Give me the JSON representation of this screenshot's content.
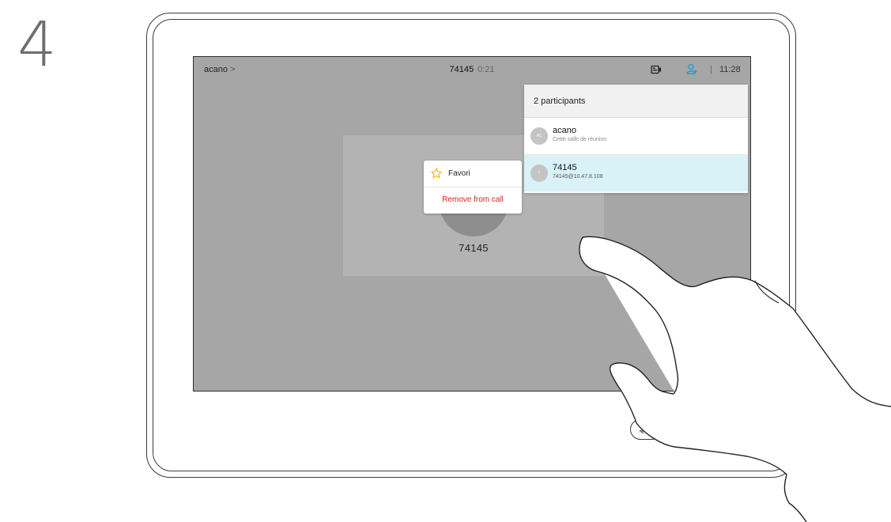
{
  "step_number": "4",
  "topbar": {
    "left_label": "acano",
    "left_chevron": ">",
    "call_number": "74145",
    "call_time": "0:21",
    "divider": "|",
    "clock": "11:28",
    "camera_icon": "camera-icon",
    "participants_icon": "person-icon"
  },
  "tile": {
    "name": "74145"
  },
  "context_menu": {
    "favorite_label": "Favori",
    "remove_label": "Remove from call",
    "favorite_icon": "star-icon"
  },
  "participants_panel": {
    "title": "2 participants",
    "participants": [
      {
        "initials": "AC",
        "name": "acano",
        "subtitle": "Cette salle de réunion"
      },
      {
        "initials": "7",
        "name": "74145",
        "subtitle": "74145@10.47.8.108"
      }
    ]
  },
  "colors": {
    "screen_bg": "#a6a6a6",
    "selected_row": "#d9f2f8",
    "remove_red": "#e0231c",
    "accent_blue": "#1ba0d7",
    "star_yellow": "#f2b700"
  }
}
